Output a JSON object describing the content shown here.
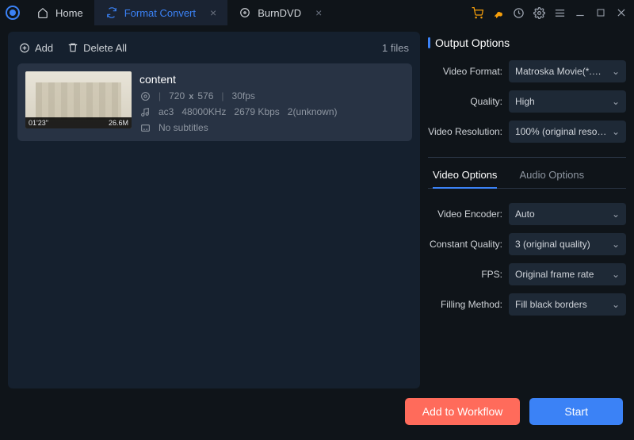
{
  "tabs": {
    "home": "Home",
    "format_convert": "Format Convert",
    "burndvd": "BurnDVD"
  },
  "accent_colors": {
    "primary": "#3b82f6",
    "workflow": "#ff6b5b",
    "cart": "#f59e0b",
    "key": "#f59e0b"
  },
  "left_panel": {
    "add_label": "Add",
    "delete_all_label": "Delete All",
    "file_count": "1 files"
  },
  "file": {
    "title": "content",
    "duration": "01'23\"",
    "size": "26.6M",
    "width": "720",
    "height": "576",
    "fps": "30fps",
    "audio_codec": "ac3",
    "audio_hz": "48000KHz",
    "audio_bitrate": "2679 Kbps",
    "audio_channels": "2(unknown)",
    "subtitles": "No subtitles"
  },
  "output_options": {
    "heading": "Output Options",
    "video_format": {
      "label": "Video Format:",
      "value": "Matroska Movie(*.m…"
    },
    "quality": {
      "label": "Quality:",
      "value": "High"
    },
    "video_resolution": {
      "label": "Video Resolution:",
      "value": "100% (original resol…"
    }
  },
  "opt_tabs": {
    "video": "Video Options",
    "audio": "Audio Options"
  },
  "video_options": {
    "video_encoder": {
      "label": "Video Encoder:",
      "value": "Auto"
    },
    "constant_quality": {
      "label": "Constant Quality:",
      "value": "3 (original quality)"
    },
    "fps": {
      "label": "FPS:",
      "value": "Original frame rate"
    },
    "filling_method": {
      "label": "Filling Method:",
      "value": "Fill black borders"
    }
  },
  "bottom": {
    "add_workflow": "Add to Workflow",
    "start": "Start"
  }
}
